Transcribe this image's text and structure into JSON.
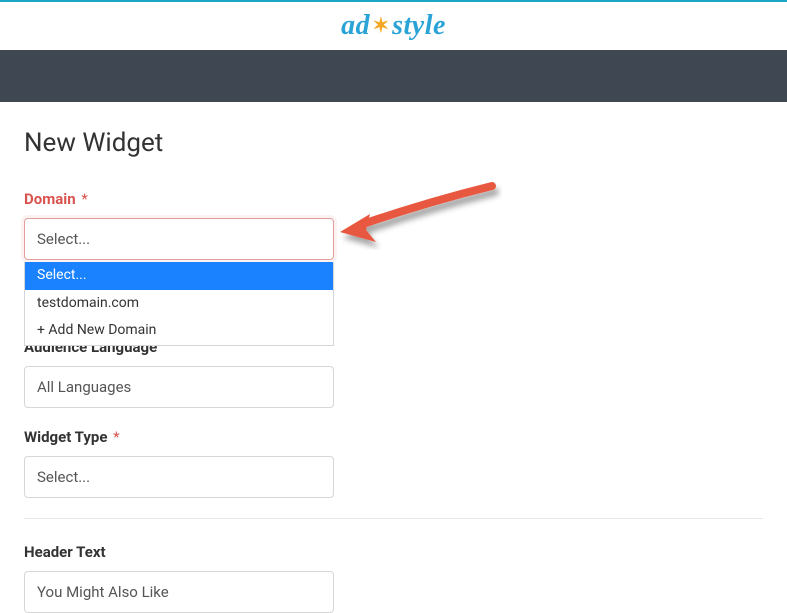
{
  "brand": {
    "part1": "ad",
    "part2": "style"
  },
  "page": {
    "title": "New Widget"
  },
  "form": {
    "domain": {
      "label": "Domain",
      "asterisk": "*",
      "value": "Select...",
      "options": {
        "placeholder": "Select...",
        "item1": "testdomain.com",
        "addNew": "+ Add New Domain"
      }
    },
    "audienceLanguage": {
      "label": "Audience Language",
      "value": "All Languages"
    },
    "widgetType": {
      "label": "Widget Type",
      "asterisk": "*",
      "value": "Select..."
    },
    "headerText": {
      "label": "Header Text",
      "value": "You Might Also Like"
    }
  }
}
